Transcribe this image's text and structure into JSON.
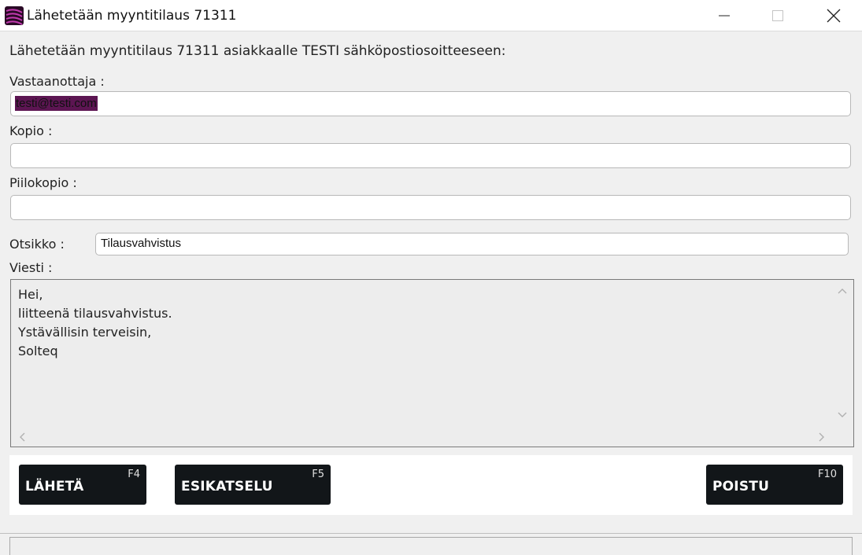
{
  "window": {
    "title": "Lähetetään myyntitilaus 71311"
  },
  "form": {
    "intro": "Lähetetään myyntitilaus 71311 asiakkaalle TESTI  sähköpostiosoitteeseen:",
    "to_label": "Vastaanottaja :",
    "to_value": "testi@testi.com",
    "cc_label": "Kopio :",
    "cc_value": "",
    "bcc_label": "Piilokopio :",
    "bcc_value": "",
    "subject_label": "Otsikko :",
    "subject_value": "Tilausvahvistus",
    "message_label": "Viesti :",
    "message_value": "Hei,\nliitteenä tilausvahvistus.\nYstävällisin terveisin,\nSolteq"
  },
  "buttons": {
    "send_label": "LÄHETÄ",
    "send_key": "F4",
    "preview_label": "ESIKATSELU",
    "preview_key": "F5",
    "exit_label": "POISTU",
    "exit_key": "F10"
  },
  "icons": {
    "app": "app-logo-icon",
    "minimize": "minimize-icon",
    "maximize": "maximize-icon",
    "close": "close-icon",
    "scroll_up": "chevron-up-icon",
    "scroll_down": "chevron-down-icon",
    "scroll_left": "chevron-left-icon",
    "scroll_right": "chevron-right-icon"
  },
  "colors": {
    "selection": "#5c1552",
    "button_bg": "#121619",
    "app_icon": "#8a1a7a"
  }
}
